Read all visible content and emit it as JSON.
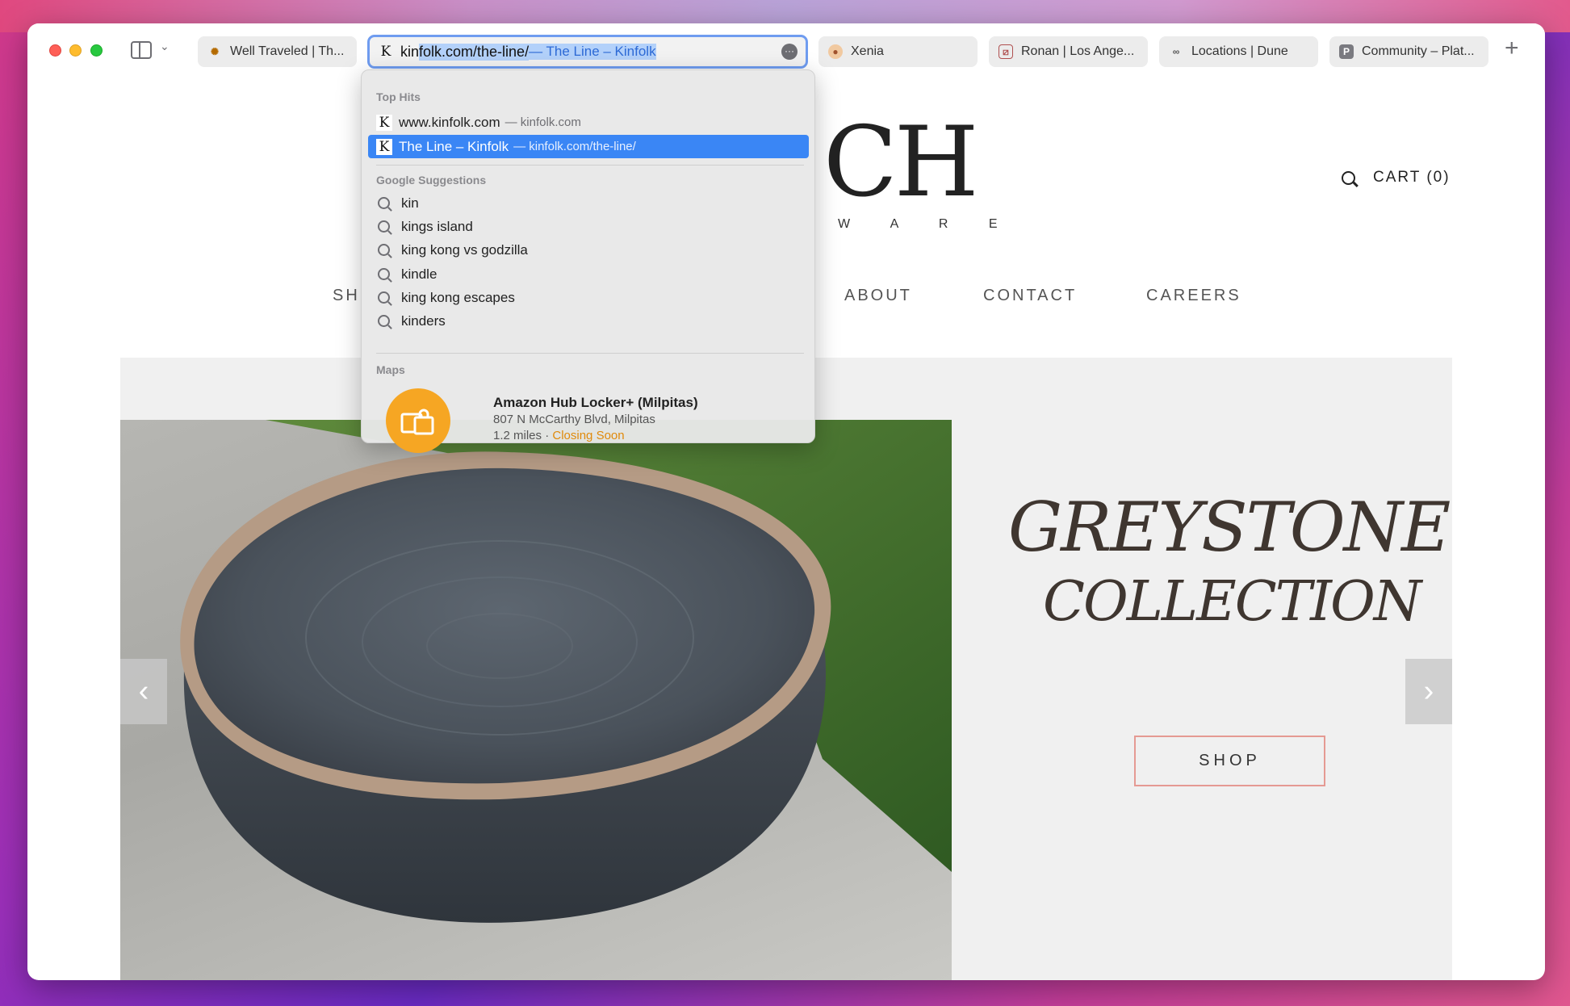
{
  "tabs": [
    {
      "label": "Well Traveled | Th...",
      "favicon": "sun-icon"
    },
    {
      "label": "Xenia",
      "favicon": "xenia-icon"
    },
    {
      "label": "Ronan | Los Ange...",
      "favicon": "ronan-icon"
    },
    {
      "label": "Locations | Dune",
      "favicon": "dune-icon"
    },
    {
      "label": "Community – Plat...",
      "favicon": "p-icon"
    }
  ],
  "address_bar": {
    "typed": "kin",
    "autocomplete": "folk.com/the-line/",
    "autocomplete_title": " — The Line – Kinfolk",
    "favicon_letter": "K"
  },
  "dropdown": {
    "top_hits_header": "Top Hits",
    "top_hits": [
      {
        "title": "www.kinfolk.com",
        "hint": "— kinfolk.com",
        "selected": false
      },
      {
        "title": "The Line – Kinfolk",
        "hint": "— kinfolk.com/the-line/",
        "selected": true
      }
    ],
    "suggestions_header": "Google Suggestions",
    "suggestions": [
      "kin",
      "kings island",
      "king kong vs godzilla",
      "kindle",
      "king kong escapes",
      "kinders"
    ],
    "maps_header": "Maps",
    "map_result": {
      "name": "Amazon Hub Locker+ (Milpitas)",
      "address": "807 N McCarthy Blvd, Milpitas",
      "distance": "1.2 miles",
      "separator": "·",
      "status": "Closing Soon"
    }
  },
  "page": {
    "logo_partial": "CH",
    "logo_sub_partial": "W A R E",
    "cart_label": "CART (0)",
    "nav": {
      "shop_partial": "SH",
      "about": "ABOUT",
      "contact": "CONTACT",
      "careers": "CAREERS"
    },
    "hero": {
      "title_line1": "GREYSTONE",
      "title_line2": "COLLECTION",
      "button": "SHOP",
      "prev_arrow": "‹",
      "next_arrow": "›"
    }
  },
  "colors": {
    "accent": "#3a86f5",
    "address_focus": "#6f9cf0",
    "shop_border": "#e59a93",
    "closing_soon": "#e08a0b",
    "map_icon": "#f6a623"
  }
}
